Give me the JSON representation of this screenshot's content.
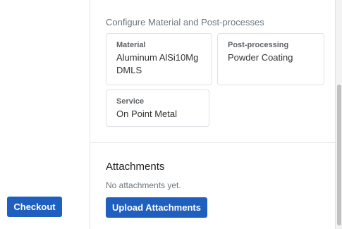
{
  "left_panel": {
    "checkout_label": "Checkout"
  },
  "configure": {
    "heading": "Configure Material and Post-processes",
    "material": {
      "label": "Material",
      "value_line1": "Aluminum AlSi10Mg",
      "value_line2": "DMLS"
    },
    "post_processing": {
      "label": "Post-processing",
      "value": "Powder Coating"
    },
    "service": {
      "label": "Service",
      "value": "On Point Metal"
    }
  },
  "attachments": {
    "title": "Attachments",
    "empty_text": "No attachments yet.",
    "upload_label": "Upload Attachments"
  },
  "colors": {
    "primary_button": "#1f5fbf",
    "muted_text": "#6c757d",
    "card_border": "#dfe2e6"
  }
}
